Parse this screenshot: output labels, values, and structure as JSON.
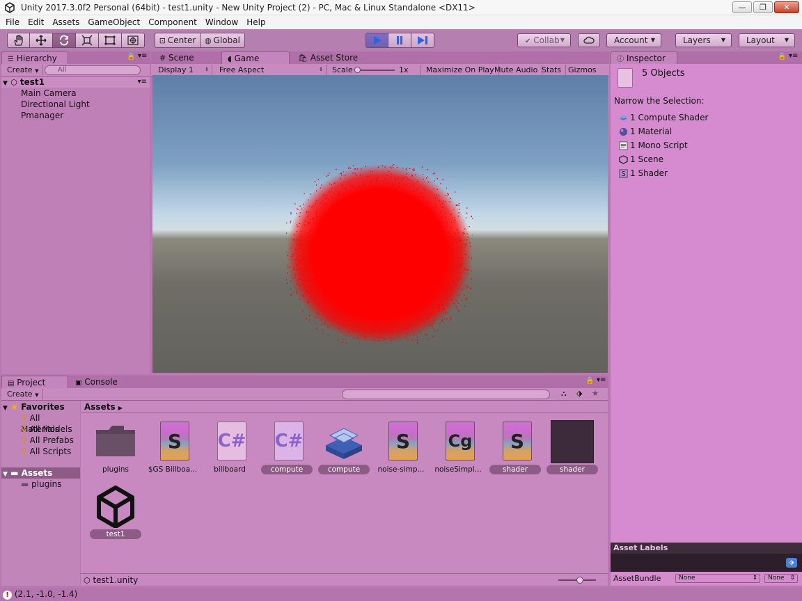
{
  "window": {
    "title": "Unity 2017.3.0f2 Personal (64bit) - test1.unity - New Unity Project (2) - PC, Mac & Linux Standalone <DX11>",
    "minimize": "—",
    "maximize": "❐",
    "close": "✕"
  },
  "menu": [
    "File",
    "Edit",
    "Assets",
    "GameObject",
    "Component",
    "Window",
    "Help"
  ],
  "toolbar": {
    "center_label": "Center",
    "global_label": "Global",
    "collab_label": "Collab",
    "account_label": "Account",
    "layers_label": "Layers",
    "layout_label": "Layout"
  },
  "hierarchy": {
    "tab": "Hierarchy",
    "create": "Create",
    "search_placeholder": "All",
    "scene": "test1",
    "items": [
      "Main Camera",
      "Directional Light",
      "Pmanager"
    ]
  },
  "center_tabs": {
    "scene": "Scene",
    "game": "Game",
    "asset_store": "Asset Store"
  },
  "game_bar": {
    "display": "Display 1",
    "aspect": "Free Aspect",
    "scale_label": "Scale",
    "scale_value": "1x",
    "maximize": "Maximize On Play",
    "mute": "Mute Audio",
    "stats": "Stats",
    "gizmos": "Gizmos"
  },
  "inspector": {
    "tab": "Inspector",
    "header": "5 Objects",
    "narrow": "Narrow the Selection:",
    "items": [
      "1 Compute Shader",
      "1 Material",
      "1 Mono Script",
      "1 Scene",
      "1 Shader"
    ]
  },
  "project": {
    "tab": "Project",
    "console_tab": "Console",
    "create": "Create",
    "favorites": "Favorites",
    "favorite_items": [
      "All Materials",
      "All Models",
      "All Prefabs",
      "All Scripts"
    ],
    "assets_root": "Assets",
    "asset_children": [
      "plugins"
    ],
    "breadcrumb": "Assets",
    "footer_path": "test1.unity",
    "assets": [
      {
        "label": "plugins",
        "selected": false
      },
      {
        "label": "$GS Billboa...",
        "selected": false
      },
      {
        "label": "billboard",
        "selected": false
      },
      {
        "label": "compute",
        "selected": true
      },
      {
        "label": "compute",
        "selected": true
      },
      {
        "label": "noise-simp...",
        "selected": false
      },
      {
        "label": "noiseSimpl...",
        "selected": false
      },
      {
        "label": "shader",
        "selected": true
      },
      {
        "label": "shader",
        "selected": true
      },
      {
        "label": "test1",
        "selected": true
      }
    ]
  },
  "asset_labels": {
    "title": "Asset Labels",
    "bundle_label": "AssetBundle",
    "bundle_value": "None",
    "variant_value": "None"
  },
  "status": "(2.1, -1.0, -1.4)",
  "colors": {
    "accent": "#be80b7",
    "particles": "#ff0000"
  }
}
